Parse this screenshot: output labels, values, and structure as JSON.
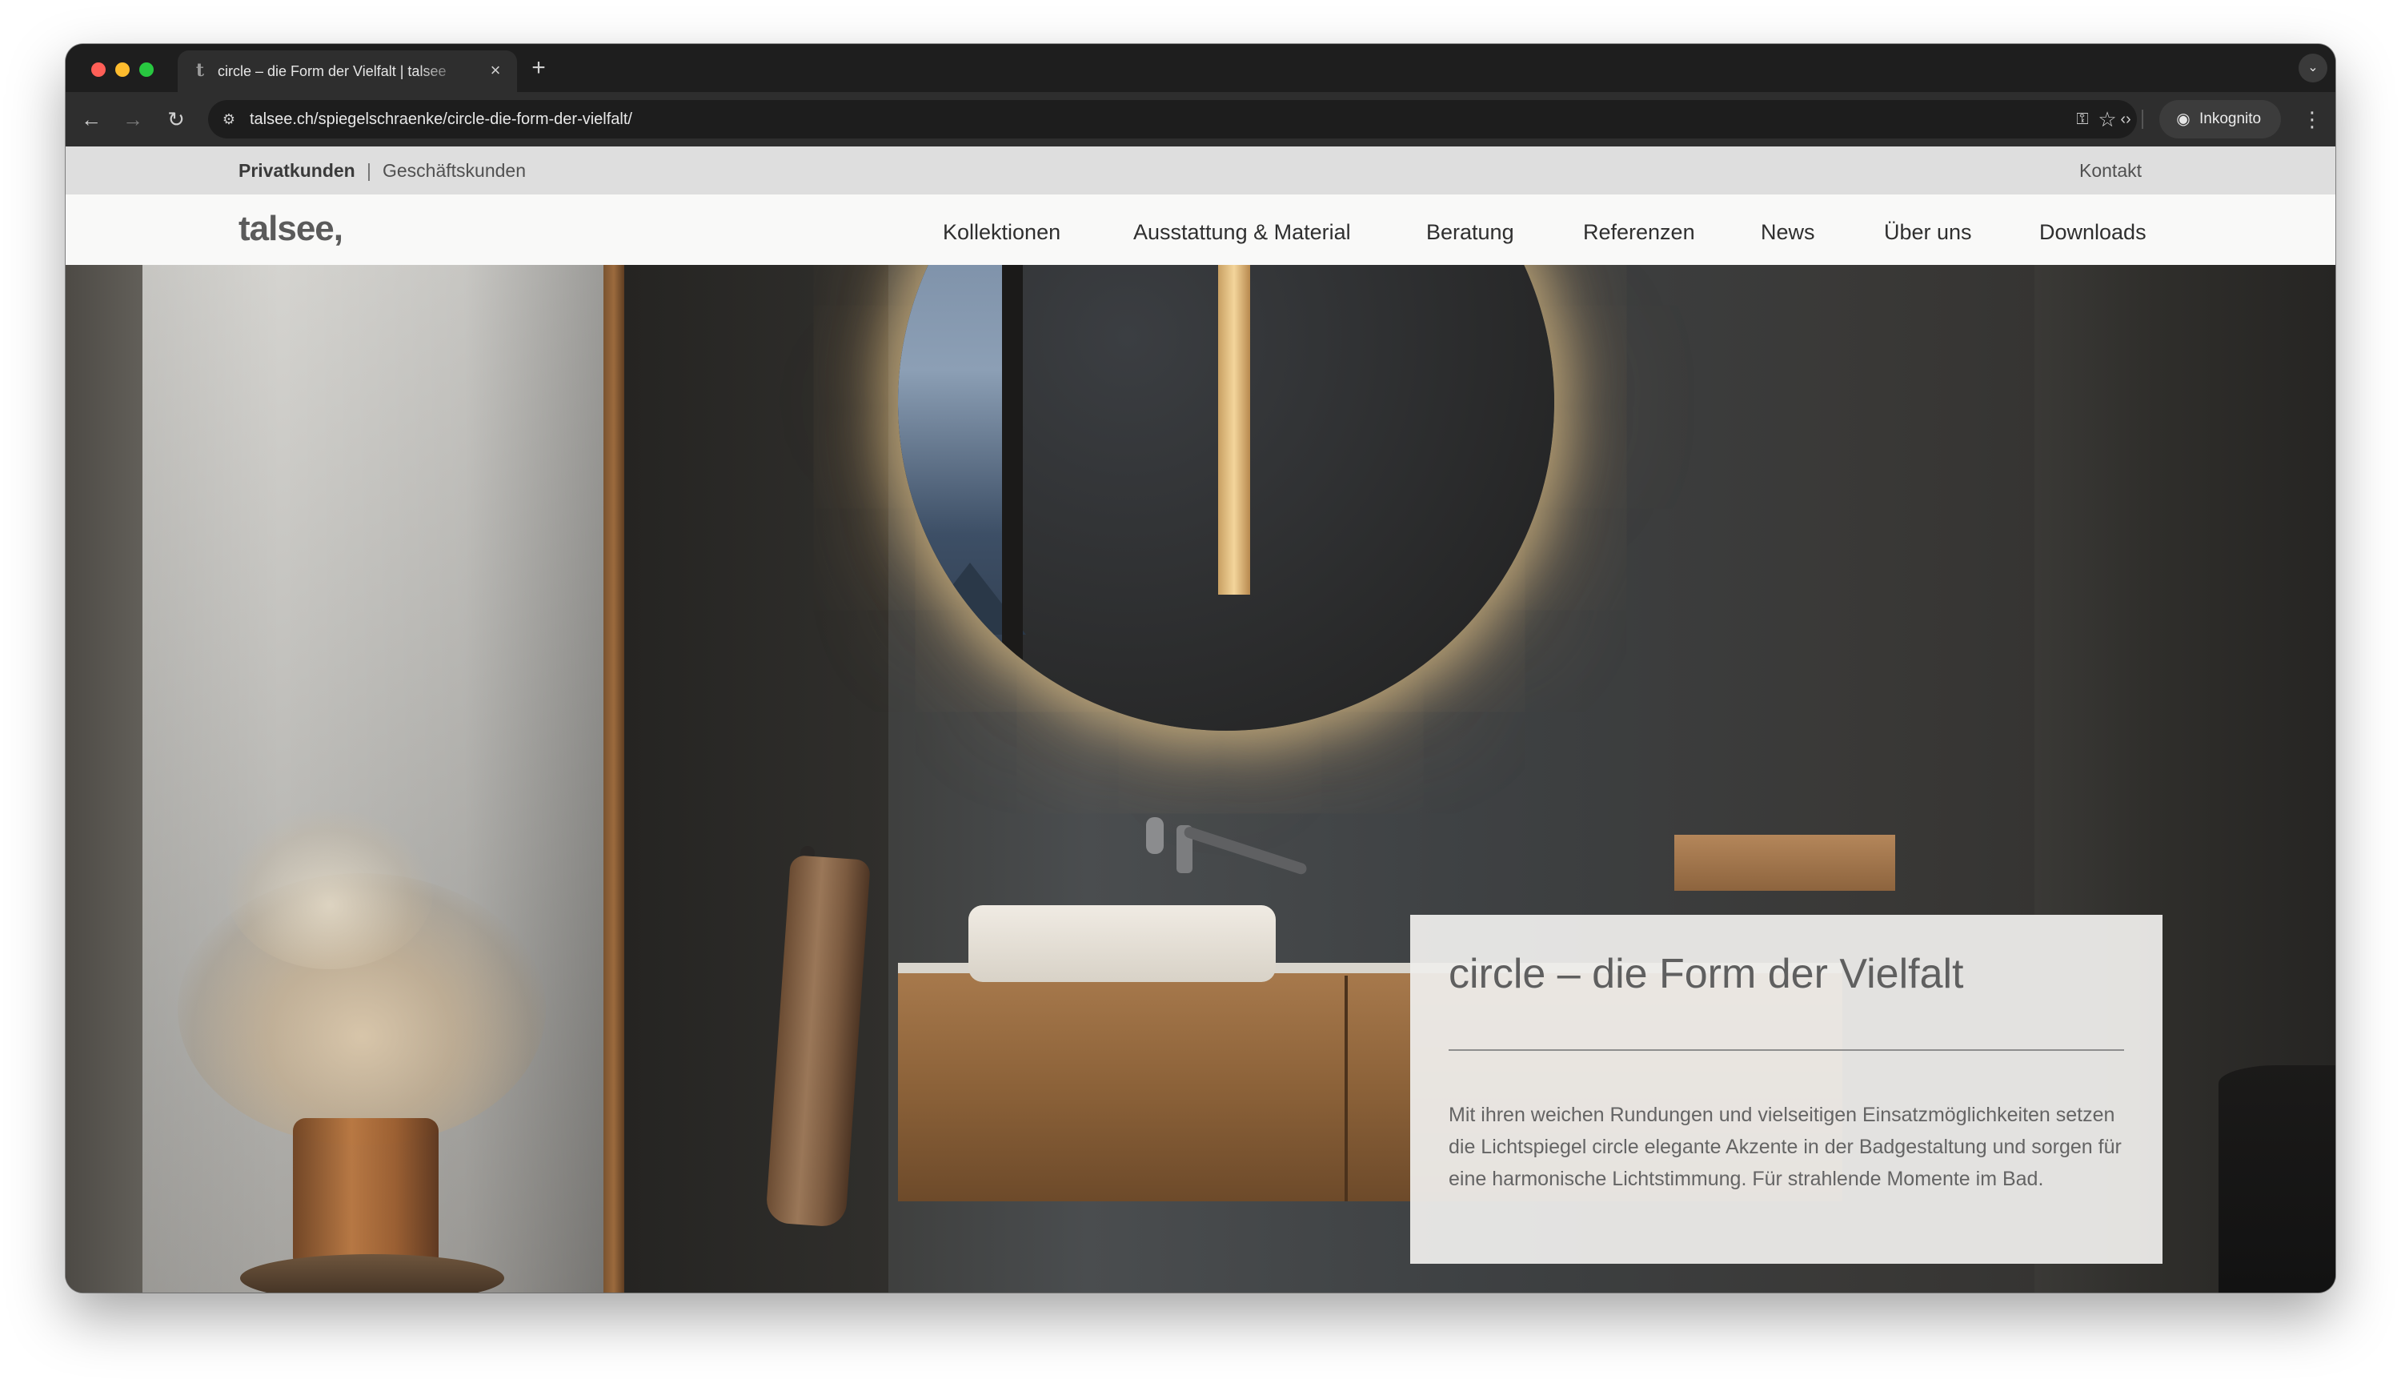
{
  "browser": {
    "tab_title": "circle – die Form der Vielfalt | talsee",
    "tab_favicon": "t",
    "url": "talsee.ch/spiegelschraenke/circle-die-form-der-vielfalt/",
    "incognito_label": "Inkognito",
    "icons": {
      "back": "arrow-left-icon",
      "forward": "arrow-right-icon",
      "reload": "reload-icon",
      "site_info": "tune-icon",
      "bookmark": "star-icon",
      "password": "key-icon",
      "devtools": "code-icon",
      "incognito": "incognito-icon",
      "menu": "kebab-icon",
      "new_tab": "plus-icon",
      "close_tab": "close-icon",
      "tab_search": "chevron-down-icon"
    }
  },
  "site": {
    "topbar": {
      "links": [
        "Privatkunden",
        "Geschäftskunden"
      ],
      "active": "Privatkunden",
      "separator": "|",
      "contact": "Kontakt"
    },
    "logo": "talsee",
    "logo_mark": ",",
    "nav": [
      "Kollektionen",
      "Ausstattung & Material",
      "Beratung",
      "Referenzen",
      "News",
      "Über uns",
      "Downloads"
    ]
  },
  "hero": {
    "image": "bathroom-hero-image",
    "title": "circle – die Form der Vielfalt",
    "text": "Mit ihren weichen Rundungen und vielseitigen Einsatzmöglichkeiten setzen die Lichtspiegel circle elegante Akzente in der Badgestaltung und sorgen für eine harmonische Lichtstimmung. Für strahlende Momente im Bad."
  },
  "colors": {
    "chrome_bg": "#1e1e1e",
    "toolbar_bg": "#2e2e2e",
    "topbar_bg": "#dedede",
    "nav_bg": "#f9f9f8",
    "card_bg": "#eeedeb",
    "mirror_glow": "#ffd996"
  }
}
